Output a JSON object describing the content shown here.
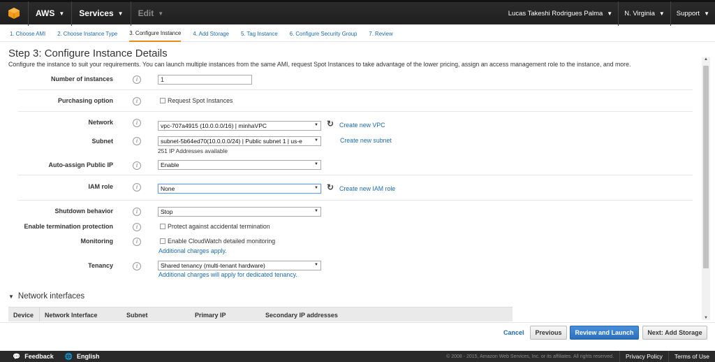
{
  "topnav": {
    "brand": "AWS",
    "services": "Services",
    "edit": "Edit",
    "user": "Lucas Takeshi Rodrigues Palma",
    "region": "N. Virginia",
    "support": "Support"
  },
  "wizard": {
    "tabs": [
      "1. Choose AMI",
      "2. Choose Instance Type",
      "3. Configure Instance",
      "4. Add Storage",
      "5. Tag Instance",
      "6. Configure Security Group",
      "7. Review"
    ],
    "active_index": 2
  },
  "page": {
    "title": "Step 3: Configure Instance Details",
    "description": "Configure the instance to suit your requirements. You can launch multiple instances from the same AMI, request Spot Instances to take advantage of the lower pricing, assign an access management role to the instance, and more."
  },
  "form": {
    "num_instances": {
      "label": "Number of instances",
      "value": "1"
    },
    "purchasing": {
      "label": "Purchasing option",
      "checkbox_label": "Request Spot Instances"
    },
    "network": {
      "label": "Network",
      "value": "vpc-707a4915 (10.0.0.0/16) | minhaVPC",
      "link": "Create new VPC"
    },
    "subnet": {
      "label": "Subnet",
      "value": "subnet-5b64ed70(10.0.0.0/24) | Public subnet 1 | us-e",
      "note": "251 IP Addresses available",
      "link": "Create new subnet"
    },
    "public_ip": {
      "label": "Auto-assign Public IP",
      "value": "Enable"
    },
    "iam_role": {
      "label": "IAM role",
      "value": "None",
      "link": "Create new IAM role"
    },
    "shutdown": {
      "label": "Shutdown behavior",
      "value": "Stop"
    },
    "termination": {
      "label": "Enable termination protection",
      "checkbox_label": "Protect against accidental termination"
    },
    "monitoring": {
      "label": "Monitoring",
      "checkbox_label": "Enable CloudWatch detailed monitoring",
      "note": "Additional charges apply."
    },
    "tenancy": {
      "label": "Tenancy",
      "value": "Shared tenancy (multi-tenant hardware)",
      "note": "Additional charges will apply for dedicated tenancy."
    }
  },
  "network_interfaces": {
    "title": "Network interfaces",
    "columns": [
      "Device",
      "Network Interface",
      "Subnet",
      "Primary IP",
      "Secondary IP addresses"
    ]
  },
  "actions": {
    "cancel": "Cancel",
    "previous": "Previous",
    "review": "Review and Launch",
    "next": "Next: Add Storage"
  },
  "footer": {
    "feedback": "Feedback",
    "language": "English",
    "copyright": "© 2008 - 2015, Amazon Web Services, Inc. or its affiliates. All rights reserved.",
    "privacy": "Privacy Policy",
    "terms": "Terms of Use"
  },
  "colors": {
    "link": "#1c6aae",
    "primary_button": "#2a6fc0",
    "active_tab_underline": "#e88b19",
    "topnav_bg": "#1f1f1f"
  }
}
